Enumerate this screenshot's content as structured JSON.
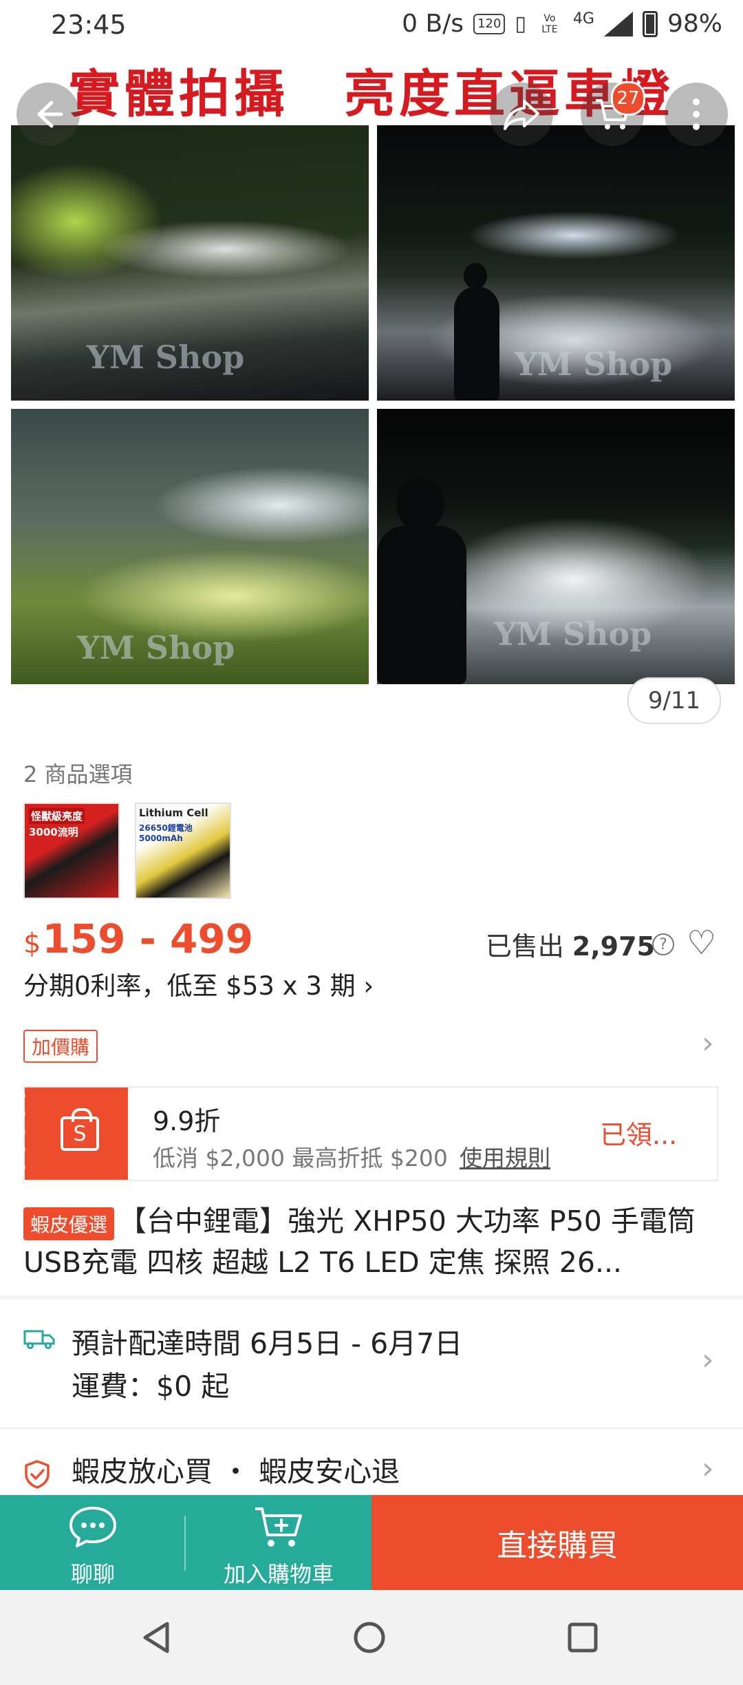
{
  "status": {
    "time": "23:45",
    "net_speed": "0 B/s",
    "refresh_chip": "120",
    "network": "4G",
    "volte": "Vo LTE",
    "battery": "98%"
  },
  "gallery": {
    "banner_text": "實體拍攝　亮度直逼車燈",
    "watermark": "YM Shop",
    "cart_count": "27",
    "counter": "9/11"
  },
  "options": {
    "title": "2 商品選項",
    "thumbs": [
      {
        "line1": "怪獸級亮度",
        "line2": "3000流明"
      },
      {
        "line1": "Lithium Cell",
        "line2": "26650鋰電池 5000mAh"
      }
    ]
  },
  "price": {
    "currency": "$",
    "range": "159 - 499",
    "sold_label": "已售出",
    "sold_count": "2,975",
    "installment": "分期0利率，低至 $53 x 3 期 ›"
  },
  "addon": {
    "label": "加價購"
  },
  "voucher": {
    "title": "9.9折",
    "desc": "低消 $2,000 最高折抵 $200",
    "rules": "使用規則",
    "status": "已領..."
  },
  "product": {
    "tag": "蝦皮優選",
    "title": "【台中鋰電】強光 XHP50 大功率 P50 手電筒 USB充電 四核 超越 L2 T6 LED 定焦 探照 26..."
  },
  "shipping": {
    "date": "預計配達時間 6月5日 - 6月7日",
    "fee": "運費：$0 起"
  },
  "guarantee": {
    "text": "蝦皮放心買 ・ 蝦皮安心退"
  },
  "bottom": {
    "chat": "聊聊",
    "add_cart": "加入購物車",
    "buy_now": "直接購買"
  },
  "colors": {
    "brand": "#ee4d2d",
    "teal": "#26aa99"
  }
}
